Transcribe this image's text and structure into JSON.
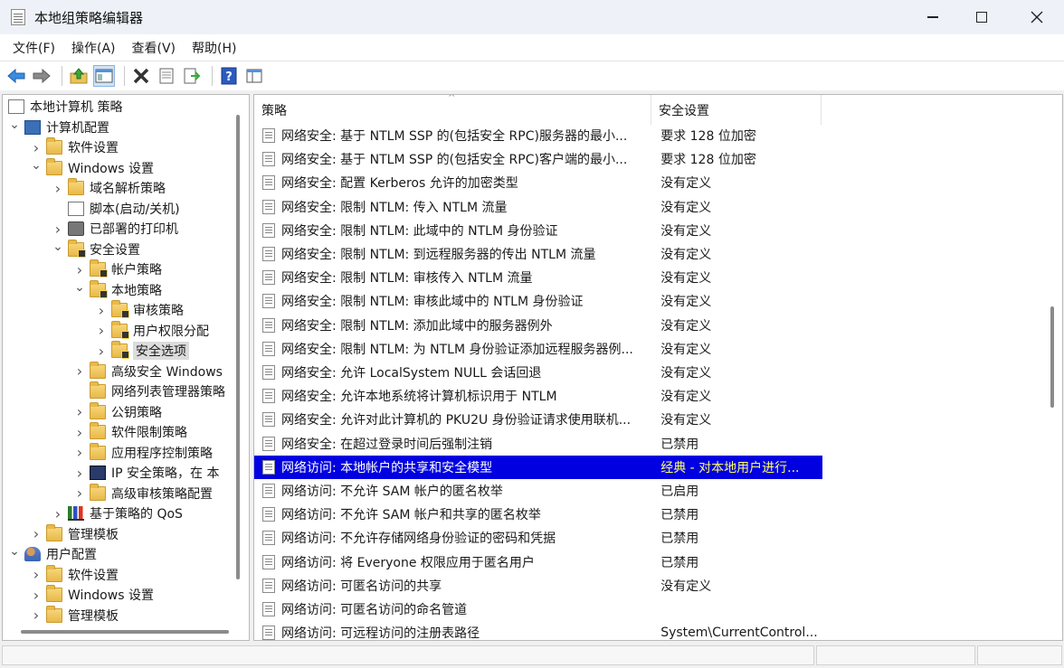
{
  "window": {
    "title": "本地组策略编辑器"
  },
  "menu": [
    "文件(F)",
    "操作(A)",
    "查看(V)",
    "帮助(H)"
  ],
  "toolbar_icons": [
    "back-icon",
    "forward-icon",
    "up-folder-icon",
    "show-hide-tree-icon",
    "delete-icon",
    "properties-icon",
    "export-icon",
    "help-icon",
    "view-icon"
  ],
  "tree": [
    {
      "label": "本地计算机 策略",
      "level": 0,
      "icon": "policy-doc",
      "expander": ""
    },
    {
      "label": "计算机配置",
      "level": 0,
      "icon": "computer",
      "expander": "open"
    },
    {
      "label": "软件设置",
      "level": 1,
      "icon": "folder",
      "expander": "closed"
    },
    {
      "label": "Windows 设置",
      "level": 1,
      "icon": "folder",
      "expander": "open"
    },
    {
      "label": "域名解析策略",
      "level": 2,
      "icon": "folder",
      "expander": "closed"
    },
    {
      "label": "脚本(启动/关机)",
      "level": 2,
      "icon": "policy-doc",
      "expander": ""
    },
    {
      "label": "已部署的打印机",
      "level": 2,
      "icon": "printer",
      "expander": "closed"
    },
    {
      "label": "安全设置",
      "level": 2,
      "icon": "folder-lock",
      "expander": "open"
    },
    {
      "label": "帐户策略",
      "level": 3,
      "icon": "folder-lock",
      "expander": "closed"
    },
    {
      "label": "本地策略",
      "level": 3,
      "icon": "folder-lock",
      "expander": "open"
    },
    {
      "label": "审核策略",
      "level": 4,
      "icon": "folder-lock",
      "expander": "closed"
    },
    {
      "label": "用户权限分配",
      "level": 4,
      "icon": "folder-lock",
      "expander": "closed"
    },
    {
      "label": "安全选项",
      "level": 4,
      "icon": "folder-lock",
      "expander": "closed",
      "selected": true
    },
    {
      "label": "高级安全 Windows",
      "level": 3,
      "icon": "folder",
      "expander": "closed"
    },
    {
      "label": "网络列表管理器策略",
      "level": 3,
      "icon": "folder",
      "expander": ""
    },
    {
      "label": "公钥策略",
      "level": 3,
      "icon": "folder",
      "expander": "closed"
    },
    {
      "label": "软件限制策略",
      "level": 3,
      "icon": "folder",
      "expander": "closed"
    },
    {
      "label": "应用程序控制策略",
      "level": 3,
      "icon": "folder",
      "expander": "closed"
    },
    {
      "label": "IP 安全策略，在 本",
      "level": 3,
      "icon": "ipsec",
      "expander": "closed"
    },
    {
      "label": "高级审核策略配置",
      "level": 3,
      "icon": "folder",
      "expander": "closed"
    },
    {
      "label": "基于策略的 QoS",
      "level": 2,
      "icon": "bars",
      "expander": "closed"
    },
    {
      "label": "管理模板",
      "level": 1,
      "icon": "folder",
      "expander": "closed"
    },
    {
      "label": "用户配置",
      "level": 0,
      "icon": "users",
      "expander": "open"
    },
    {
      "label": "软件设置",
      "level": 1,
      "icon": "folder",
      "expander": "closed"
    },
    {
      "label": "Windows 设置",
      "level": 1,
      "icon": "folder",
      "expander": "closed"
    },
    {
      "label": "管理模板",
      "level": 1,
      "icon": "folder",
      "expander": "closed"
    }
  ],
  "list": {
    "columns": [
      "策略",
      "安全设置"
    ],
    "rows": [
      {
        "policy": "网络安全: 基于 NTLM SSP 的(包括安全 RPC)服务器的最小...",
        "setting": "要求 128 位加密"
      },
      {
        "policy": "网络安全: 基于 NTLM SSP 的(包括安全 RPC)客户端的最小...",
        "setting": "要求 128 位加密"
      },
      {
        "policy": "网络安全: 配置 Kerberos 允许的加密类型",
        "setting": "没有定义"
      },
      {
        "policy": "网络安全: 限制 NTLM: 传入 NTLM 流量",
        "setting": "没有定义"
      },
      {
        "policy": "网络安全: 限制 NTLM: 此域中的 NTLM 身份验证",
        "setting": "没有定义"
      },
      {
        "policy": "网络安全: 限制 NTLM: 到远程服务器的传出 NTLM 流量",
        "setting": "没有定义"
      },
      {
        "policy": "网络安全: 限制 NTLM: 审核传入 NTLM 流量",
        "setting": "没有定义"
      },
      {
        "policy": "网络安全: 限制 NTLM: 审核此域中的 NTLM 身份验证",
        "setting": "没有定义"
      },
      {
        "policy": "网络安全: 限制 NTLM: 添加此域中的服务器例外",
        "setting": "没有定义"
      },
      {
        "policy": "网络安全: 限制 NTLM: 为 NTLM 身份验证添加远程服务器例...",
        "setting": "没有定义"
      },
      {
        "policy": "网络安全: 允许 LocalSystem NULL 会话回退",
        "setting": "没有定义"
      },
      {
        "policy": "网络安全: 允许本地系统将计算机标识用于 NTLM",
        "setting": "没有定义"
      },
      {
        "policy": "网络安全: 允许对此计算机的 PKU2U 身份验证请求使用联机...",
        "setting": "没有定义"
      },
      {
        "policy": "网络安全: 在超过登录时间后强制注销",
        "setting": "已禁用"
      },
      {
        "policy": "网络访问: 本地帐户的共享和安全模型",
        "setting": "经典 - 对本地用户进行...",
        "selected": true
      },
      {
        "policy": "网络访问: 不允许 SAM 帐户的匿名枚举",
        "setting": "已启用"
      },
      {
        "policy": "网络访问: 不允许 SAM 帐户和共享的匿名枚举",
        "setting": "已禁用"
      },
      {
        "policy": "网络访问: 不允许存储网络身份验证的密码和凭据",
        "setting": "已禁用"
      },
      {
        "policy": "网络访问: 将 Everyone 权限应用于匿名用户",
        "setting": "已禁用"
      },
      {
        "policy": "网络访问: 可匿名访问的共享",
        "setting": "没有定义"
      },
      {
        "policy": "网络访问: 可匿名访问的命名管道",
        "setting": ""
      },
      {
        "policy": "网络访问: 可远程访问的注册表路径",
        "setting": "System\\CurrentControl..."
      }
    ]
  }
}
